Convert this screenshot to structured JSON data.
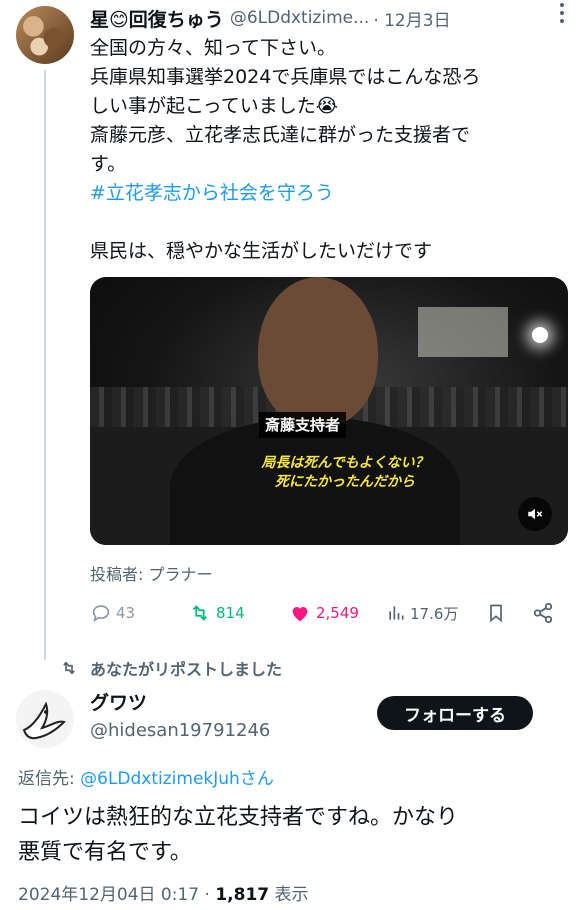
{
  "tweet": {
    "author_name": "星😊回復ちゅう",
    "handle": "@6LDdxtizime...",
    "date": "· 12月3日",
    "lines": [
      "全国の方々、知って下さい。",
      "兵庫県知事選挙2024で兵庫県ではこんな恐ろ",
      "しい事が起こっていました😭",
      "斎藤元彦、立花孝志氏達に群がった支援者で",
      "す。"
    ],
    "hashtag": "#立花孝志から社会を守ろう",
    "closing_line": "県民は、穏やかな生活がしたいだけです",
    "media": {
      "caption_label": "斎藤支持者",
      "subtitle_line1": "局長は死んでもよくない？",
      "subtitle_line2": "死にたかったんだから"
    },
    "poster": "投稿者: プラナー",
    "actions": {
      "replies": "43",
      "reposts": "814",
      "likes": "2,549",
      "views": "17.6万"
    }
  },
  "repost_banner": "あなたがリポストしました",
  "reply": {
    "author_name": "グワツ",
    "handle": "@hidesan19791246",
    "follow_label": "フォローする",
    "reply_to_prefix": "返信先: ",
    "reply_to_mention": "@6LDdxtizimekJuhさん",
    "lines": [
      "コイツは熱狂的な立花支持者ですね。かなり",
      "悪質で有名です。"
    ],
    "timestamp": "2024年12月04日 0:17 · ",
    "view_count": "1,817",
    "view_suffix": " 表示"
  },
  "colors": {
    "accent": "#1d9bf0",
    "repost": "#00ba7c",
    "like": "#f91880",
    "muted": "#536471",
    "text": "#0f1419"
  }
}
